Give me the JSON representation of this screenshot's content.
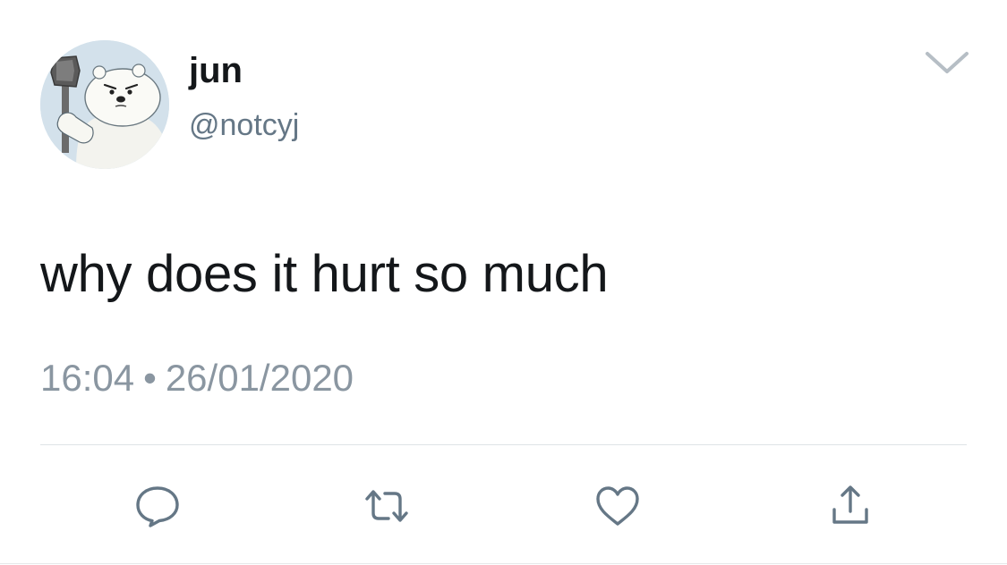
{
  "tweet": {
    "author": {
      "display_name": "jun",
      "handle": "@notcyj",
      "avatar_icon": "polar-bear-with-axe-avatar"
    },
    "text": "why does it hurt so much",
    "time": "16:04",
    "separator": "•",
    "date": "26/01/2020"
  },
  "actions": [
    {
      "name": "reply",
      "icon": "reply-icon"
    },
    {
      "name": "retweet",
      "icon": "retweet-icon"
    },
    {
      "name": "like",
      "icon": "heart-icon"
    },
    {
      "name": "share",
      "icon": "share-icon"
    }
  ],
  "colors": {
    "text": "#14171a",
    "secondary": "#657786",
    "meta": "#8a96a1",
    "icon": "#657786",
    "divider": "#dfe3e6"
  }
}
